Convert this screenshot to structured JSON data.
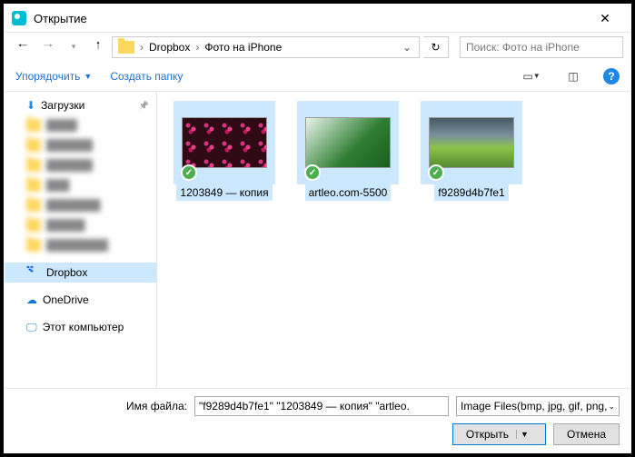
{
  "title": "Открытие",
  "nav": {
    "crumbs": [
      "Dropbox",
      "Фото на iPhone"
    ],
    "search_placeholder": "Поиск: Фото на iPhone"
  },
  "toolbar": {
    "organize": "Упорядочить",
    "newfolder": "Создать папку"
  },
  "sidebar": {
    "downloads": "Загрузки",
    "dropbox": "Dropbox",
    "onedrive": "OneDrive",
    "thispc": "Этот компьютер"
  },
  "files": [
    {
      "name": "1203849 — копия"
    },
    {
      "name": "artleo.com-5500"
    },
    {
      "name": "f9289d4b7fe1"
    }
  ],
  "footer": {
    "filename_label": "Имя файла:",
    "filename_value": "\"f9289d4b7fe1\" \"1203849 — копия\" \"artleo.",
    "filter": "Image Files(bmp, jpg, gif, png,",
    "open": "Открыть",
    "cancel": "Отмена"
  }
}
